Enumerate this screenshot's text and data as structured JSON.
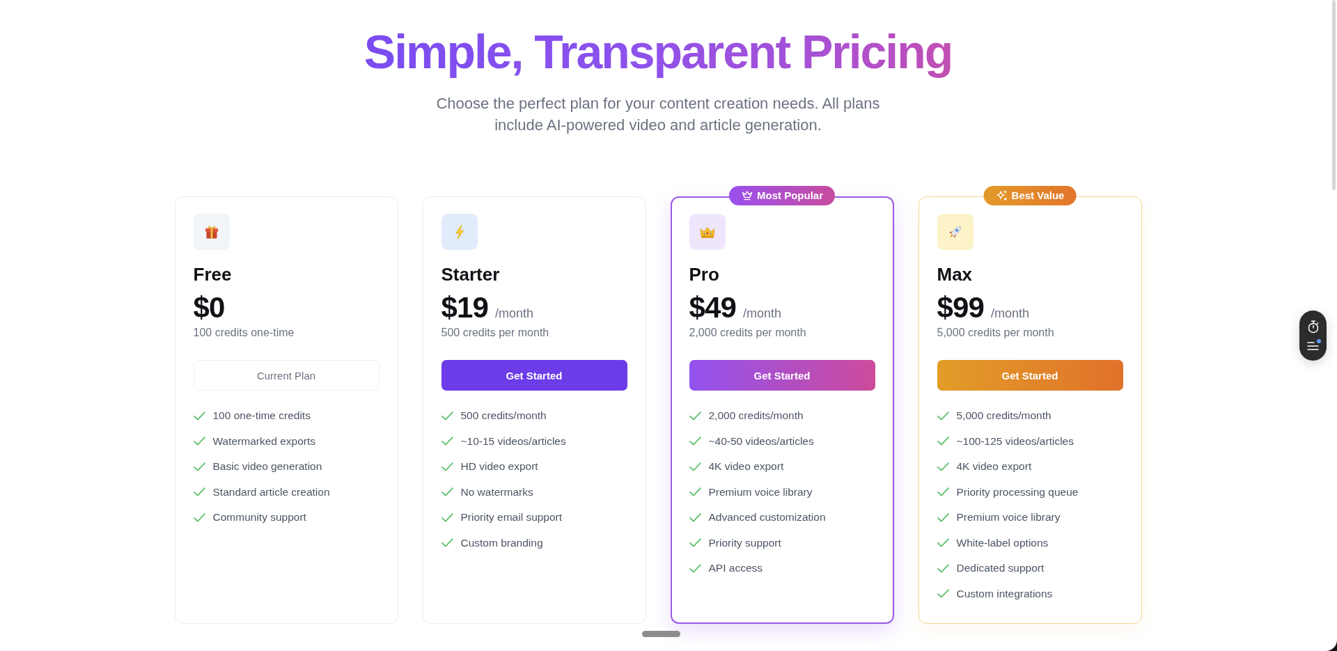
{
  "heading": {
    "title": "Simple, Transparent Pricing",
    "subtitle": "Choose the perfect plan for your content creation needs. All plans include AI-powered video and article generation."
  },
  "plans": [
    {
      "kind": "basic",
      "name": "Free",
      "price": "$0",
      "credits": "100 credits one-time",
      "button": {
        "label": "Current Plan",
        "disabled": true
      },
      "features": [
        "100 one-time credits",
        "Watermarked exports",
        "Basic video generation",
        "Standard article creation",
        "Community support"
      ]
    },
    {
      "kind": "starter",
      "name": "Starter",
      "price": "$19",
      "period": "/month",
      "credits": "500 credits per month",
      "button": {
        "label": "Get Started",
        "disabled": false
      },
      "features": [
        "500 credits/month",
        "~10-15 videos/articles",
        "HD video export",
        "No watermarks",
        "Priority email support",
        "Custom branding"
      ]
    },
    {
      "kind": "popular",
      "badge": "Most Popular",
      "name": "Pro",
      "price": "$49",
      "period": "/month",
      "credits": "2,000 credits per month",
      "button": {
        "label": "Get Started",
        "disabled": false
      },
      "features": [
        "2,000 credits/month",
        "~40-50 videos/articles",
        "4K video export",
        "Premium voice library",
        "Advanced customization",
        "Priority support",
        "API access"
      ]
    },
    {
      "kind": "value",
      "badge": "Best Value",
      "name": "Max",
      "price": "$99",
      "period": "/month",
      "credits": "5,000 credits per month",
      "button": {
        "label": "Get Started",
        "disabled": false
      },
      "features": [
        "5,000 credits/month",
        "~100-125 videos/articles",
        "4K video export",
        "Priority processing queue",
        "Premium voice library",
        "White-label options",
        "Dedicated support",
        "Custom integrations"
      ]
    }
  ],
  "floating_toolbar": {
    "notification": true
  }
}
